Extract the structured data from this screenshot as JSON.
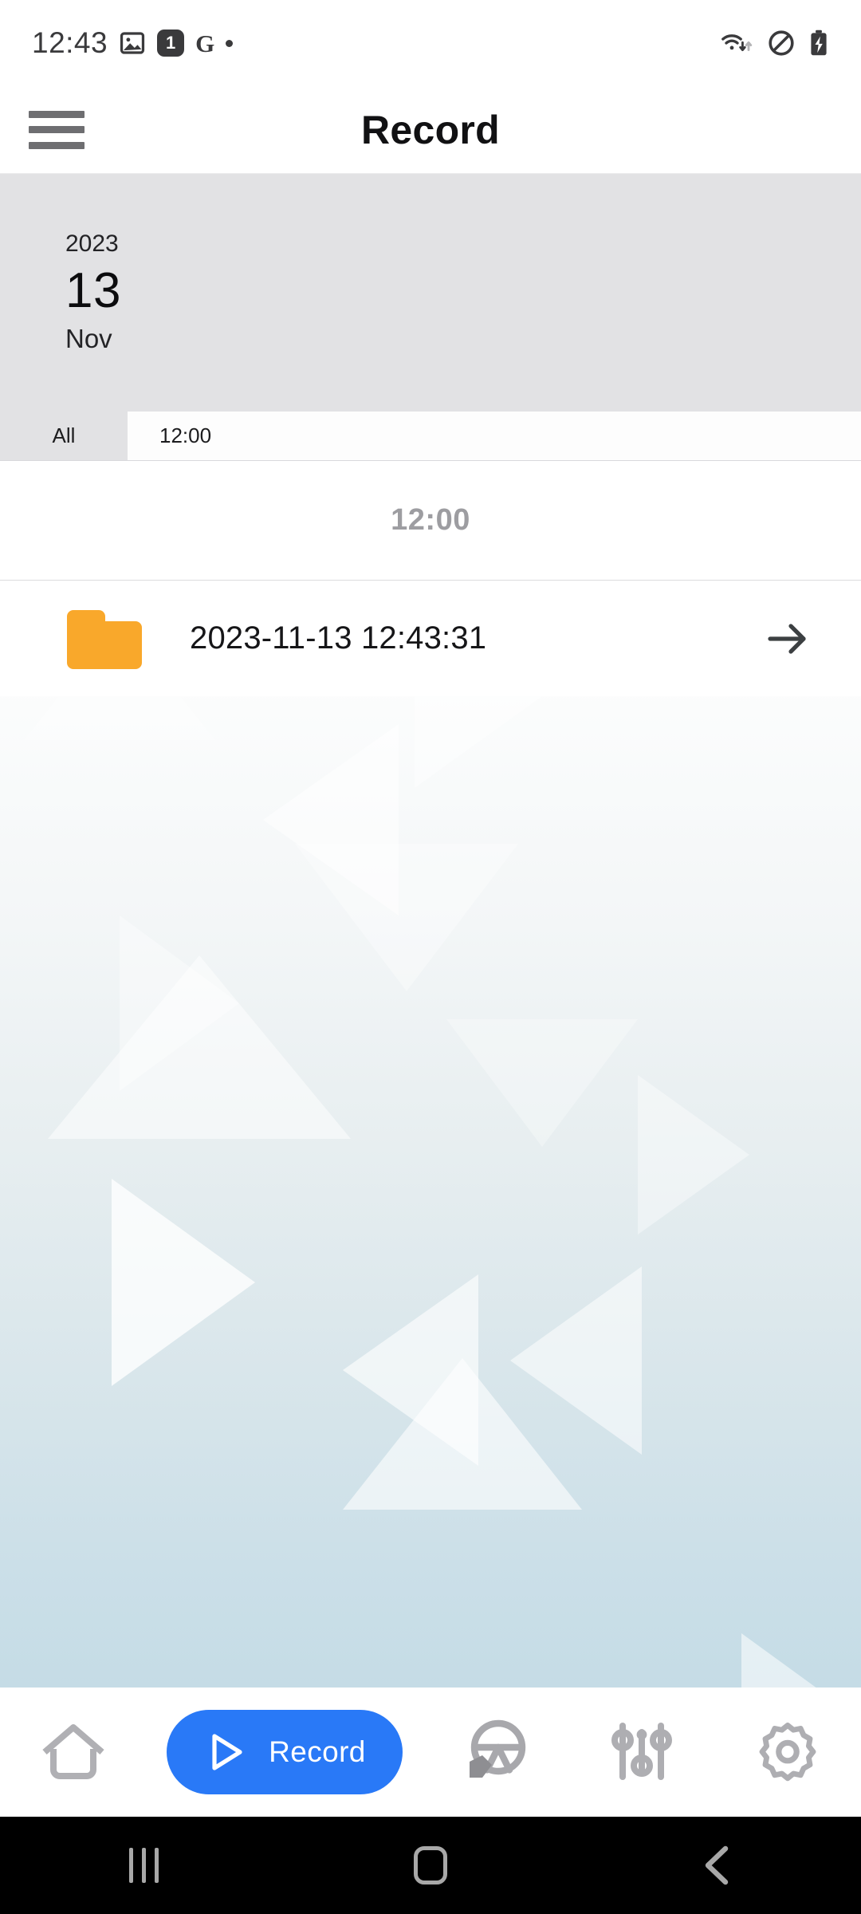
{
  "status_bar": {
    "clock": "12:43",
    "notification_badge": "1",
    "google_icon_letter": "G",
    "icons_left": [
      "image-icon",
      "notification-badge-icon",
      "google-icon",
      "dot-icon"
    ],
    "icons_right": [
      "wifi-icon",
      "do-not-disturb-icon",
      "battery-charging-icon"
    ]
  },
  "app_bar": {
    "menu_icon": "hamburger-menu-icon",
    "title": "Record"
  },
  "date_panel": {
    "year": "2023",
    "day": "13",
    "month": "Nov",
    "background_color": "#e2e2e4"
  },
  "tabs": {
    "items": [
      {
        "label": "All",
        "selected": true
      },
      {
        "label": "12:00",
        "selected": false
      }
    ]
  },
  "list": {
    "section_header": "12:00",
    "rows": [
      {
        "icon": "folder-icon",
        "icon_color": "#F9A82B",
        "name": "2023-11-13 12:43:31",
        "chevron": "arrow-right-icon"
      }
    ]
  },
  "bottom_nav": {
    "accent_color": "#2979F7",
    "items": [
      {
        "icon": "home-icon",
        "label": "",
        "active": false
      },
      {
        "icon": "play-icon",
        "label": "Record",
        "active": true
      },
      {
        "icon": "steering-wheel-icon",
        "label": "",
        "active": false
      },
      {
        "icon": "sliders-icon",
        "label": "",
        "active": false
      },
      {
        "icon": "gear-icon",
        "label": "",
        "active": false
      }
    ]
  },
  "android_nav": {
    "items": [
      "recents-icon",
      "home-icon",
      "back-icon"
    ]
  }
}
